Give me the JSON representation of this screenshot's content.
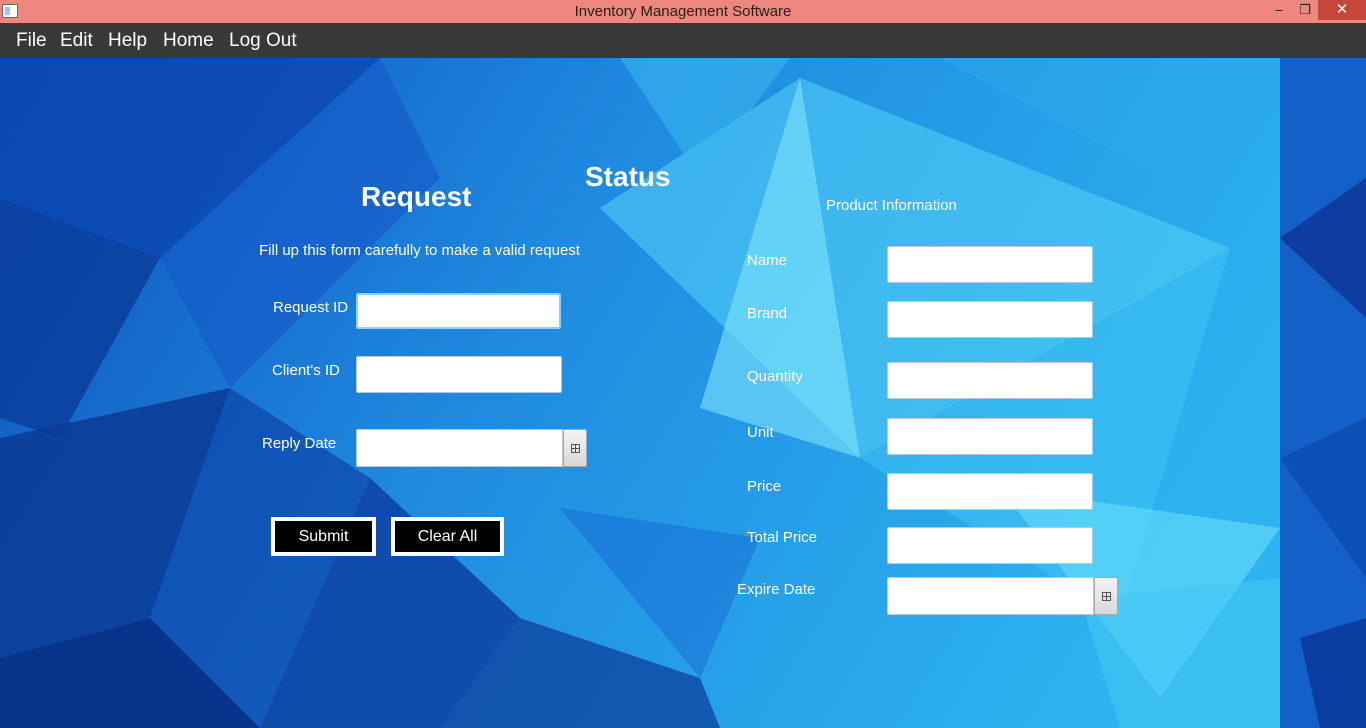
{
  "window": {
    "title": "Inventory Management Software",
    "minimize": "–",
    "maximize": "❐",
    "close": "✕"
  },
  "menu": {
    "file": "File",
    "edit": "Edit",
    "help": "Help",
    "home": "Home",
    "logout": "Log Out"
  },
  "request": {
    "title": "Request",
    "subtitle": "Fill up this form carefully to make a valid request",
    "request_id_label": "Request ID",
    "client_id_label": "Client's ID",
    "reply_date_label": "Reply Date",
    "submit_label": "Submit",
    "clear_label": "Clear All"
  },
  "status": {
    "title": "Status"
  },
  "product": {
    "title": "Product Information",
    "name_label": "Name",
    "brand_label": "Brand",
    "quantity_label": "Quantity",
    "unit_label": "Unit",
    "price_label": "Price",
    "total_price_label": "Total Price",
    "expire_date_label": "Expire Date"
  },
  "colors": {
    "title_bar": "#ee877d",
    "menu_bar": "#383838",
    "background": "#1a6fd0",
    "button": "#000000"
  }
}
